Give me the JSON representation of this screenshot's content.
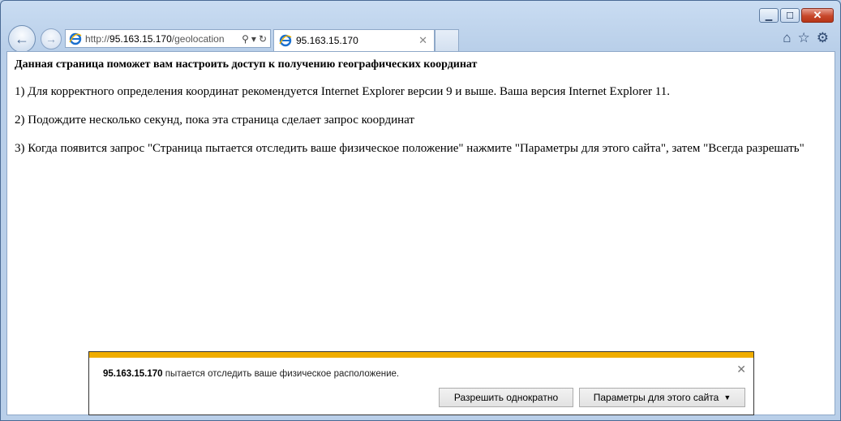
{
  "window": {
    "minimize_glyph": "▁",
    "maximize_glyph": "☐",
    "close_glyph": "✕"
  },
  "nav": {
    "back_icon": "back-arrow-icon",
    "forward_icon": "forward-arrow-icon"
  },
  "address": {
    "url_host": "95.163.15.170",
    "url_rest": "/geolocation",
    "search_glyph": "⚲",
    "dropdown_glyph": "▾",
    "refresh_glyph": "↻"
  },
  "tab": {
    "title": "95.163.15.170",
    "close_glyph": "✕"
  },
  "toolbar_icons": [
    "home-icon",
    "favorites-star-icon",
    "settings-gear-icon"
  ],
  "page": {
    "heading": "Данная страница поможет вам настроить доступ к получению географических координат",
    "step1": "1) Для корректного определения координат рекомендуется Internet Explorer версии 9 и выше. Ваша версия Internet Explorer 11.",
    "step2": "2) Подождите несколько секунд, пока эта страница сделает запрос координат",
    "step3": "3) Когда появится запрос \"Страница пытается отследить ваше физическое положение\" нажмите \"Параметры для этого сайта\", затем \"Всегда разрешать\""
  },
  "notification": {
    "host": "95.163.15.170",
    "message": " пытается отследить ваше физическое расположение.",
    "allow_once_label": "Разрешить однократно",
    "site_options_label": "Параметры для этого сайта",
    "close_glyph": "✕",
    "accent_color": "#f0ad00"
  }
}
